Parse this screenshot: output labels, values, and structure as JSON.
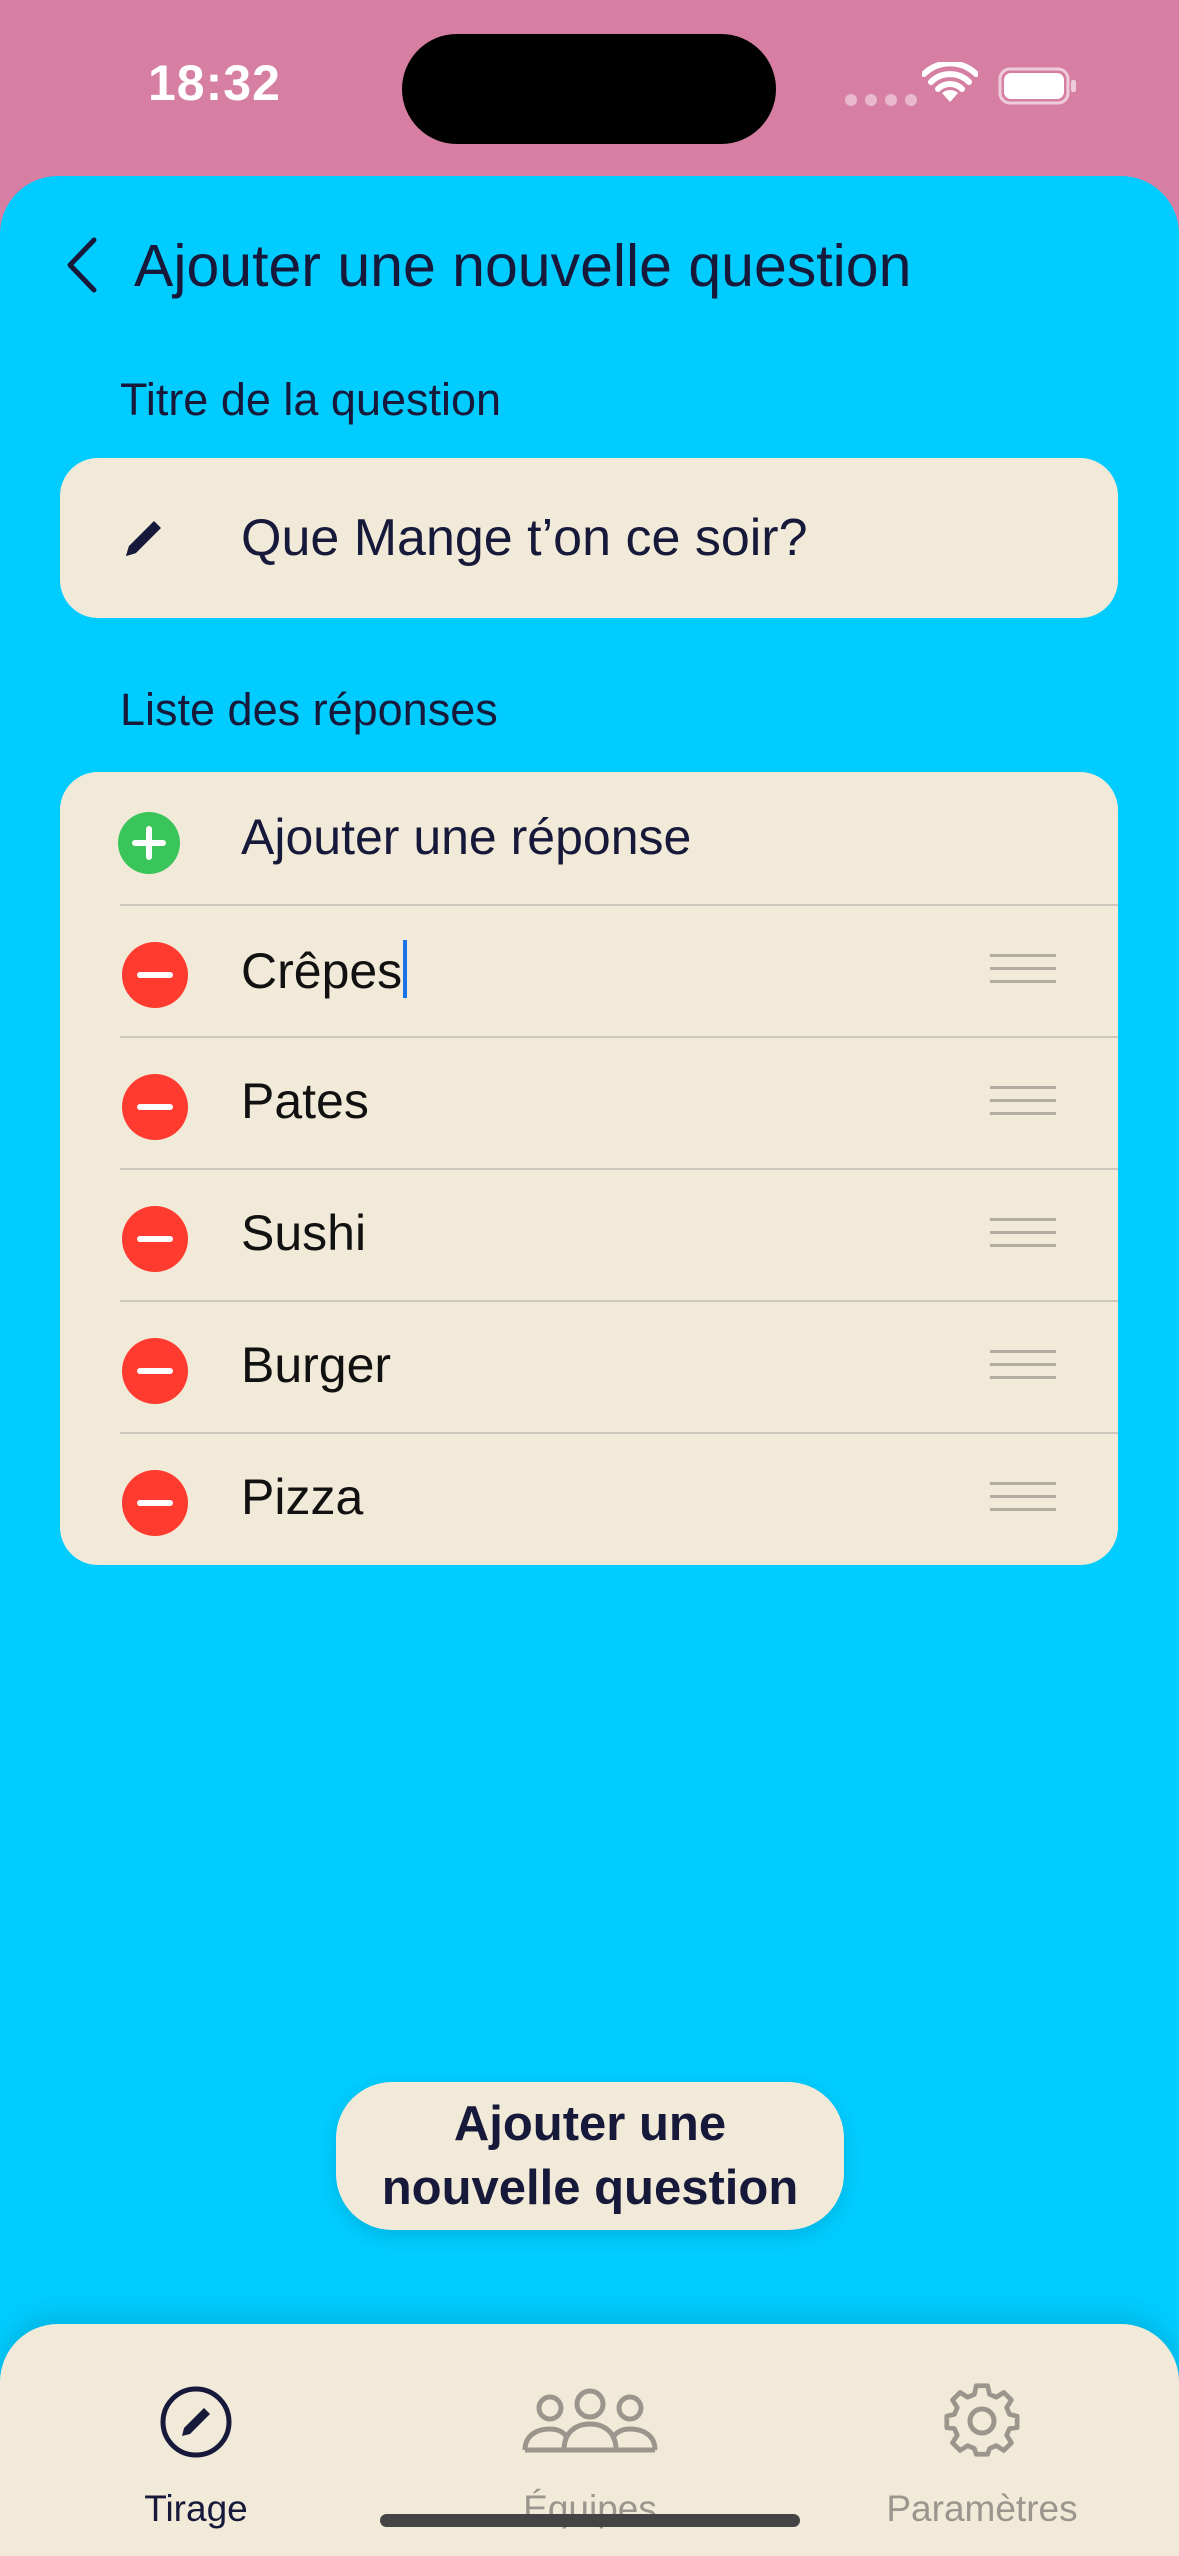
{
  "status_bar": {
    "time": "18:32"
  },
  "header": {
    "title": "Ajouter une nouvelle question",
    "back_icon": "chevron-left-icon"
  },
  "question_section": {
    "label": "Titre de la question",
    "input_value": "Que Mange t’on ce soir?",
    "icon": "pencil-icon"
  },
  "answers_section": {
    "label": "Liste des réponses",
    "add_label": "Ajouter une réponse",
    "items": [
      {
        "label": "Crêpes",
        "focused": true
      },
      {
        "label": "Pates"
      },
      {
        "label": "Sushi"
      },
      {
        "label": "Burger"
      },
      {
        "label": "Pizza"
      }
    ]
  },
  "submit_button": {
    "line1": "Ajouter une",
    "line2": "nouvelle question"
  },
  "tab_bar": {
    "tabs": [
      {
        "label": "Tirage",
        "icon": "pencil-circle-icon",
        "active": true
      },
      {
        "label": "Équipes",
        "icon": "people-icon",
        "active": false
      },
      {
        "label": "Paramètres",
        "icon": "gear-icon",
        "active": false
      }
    ]
  },
  "colors": {
    "status_background": "#d67fa3",
    "sheet_background": "#00ccff",
    "card_background": "#f2ead8",
    "text_dark": "#16193a",
    "add_green": "#3ac55a",
    "remove_red": "#ff3b30",
    "caret_blue": "#1a73e8"
  }
}
